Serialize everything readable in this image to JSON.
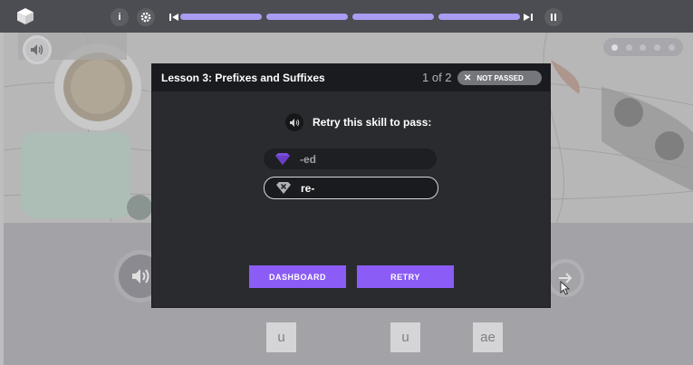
{
  "topbar": {
    "logo_icon": "cube-icon",
    "info_label": "i",
    "settings_icon": "gear-icon",
    "skip_back_icon": "skip-back-icon",
    "skip_forward_icon": "skip-forward-icon",
    "pause_icon": "pause-icon",
    "progress_segments": 4
  },
  "photo_volume_icon": "speaker-icon",
  "carousel": {
    "dots": 5,
    "active_index": 0
  },
  "modal": {
    "title": "Lesson 3:  Prefixes and Suffixes",
    "count": "1 of 2",
    "status_badge": "NOT PASSED",
    "status_badge_icon": "close-icon",
    "retry_prompt": "Retry this skill to pass:",
    "retry_speaker_icon": "speaker-icon",
    "skills": [
      {
        "label": "-ed",
        "icon": "gem-icon",
        "state": "passed"
      },
      {
        "label": "re-",
        "icon": "gem-x-icon",
        "state": "failed"
      }
    ],
    "dashboard_label": "DASHBOARD",
    "retry_label": "RETRY"
  },
  "bottom": {
    "speaker_icon": "speaker-icon",
    "next_icon": "arrow-right-icon",
    "tiles": [
      "u",
      "u",
      "ae"
    ]
  },
  "colors": {
    "accent": "#8b5cf6",
    "progress": "#a99cf2",
    "modal_bg": "#2a2b2f",
    "gem_purple": "#7c4ddc"
  }
}
